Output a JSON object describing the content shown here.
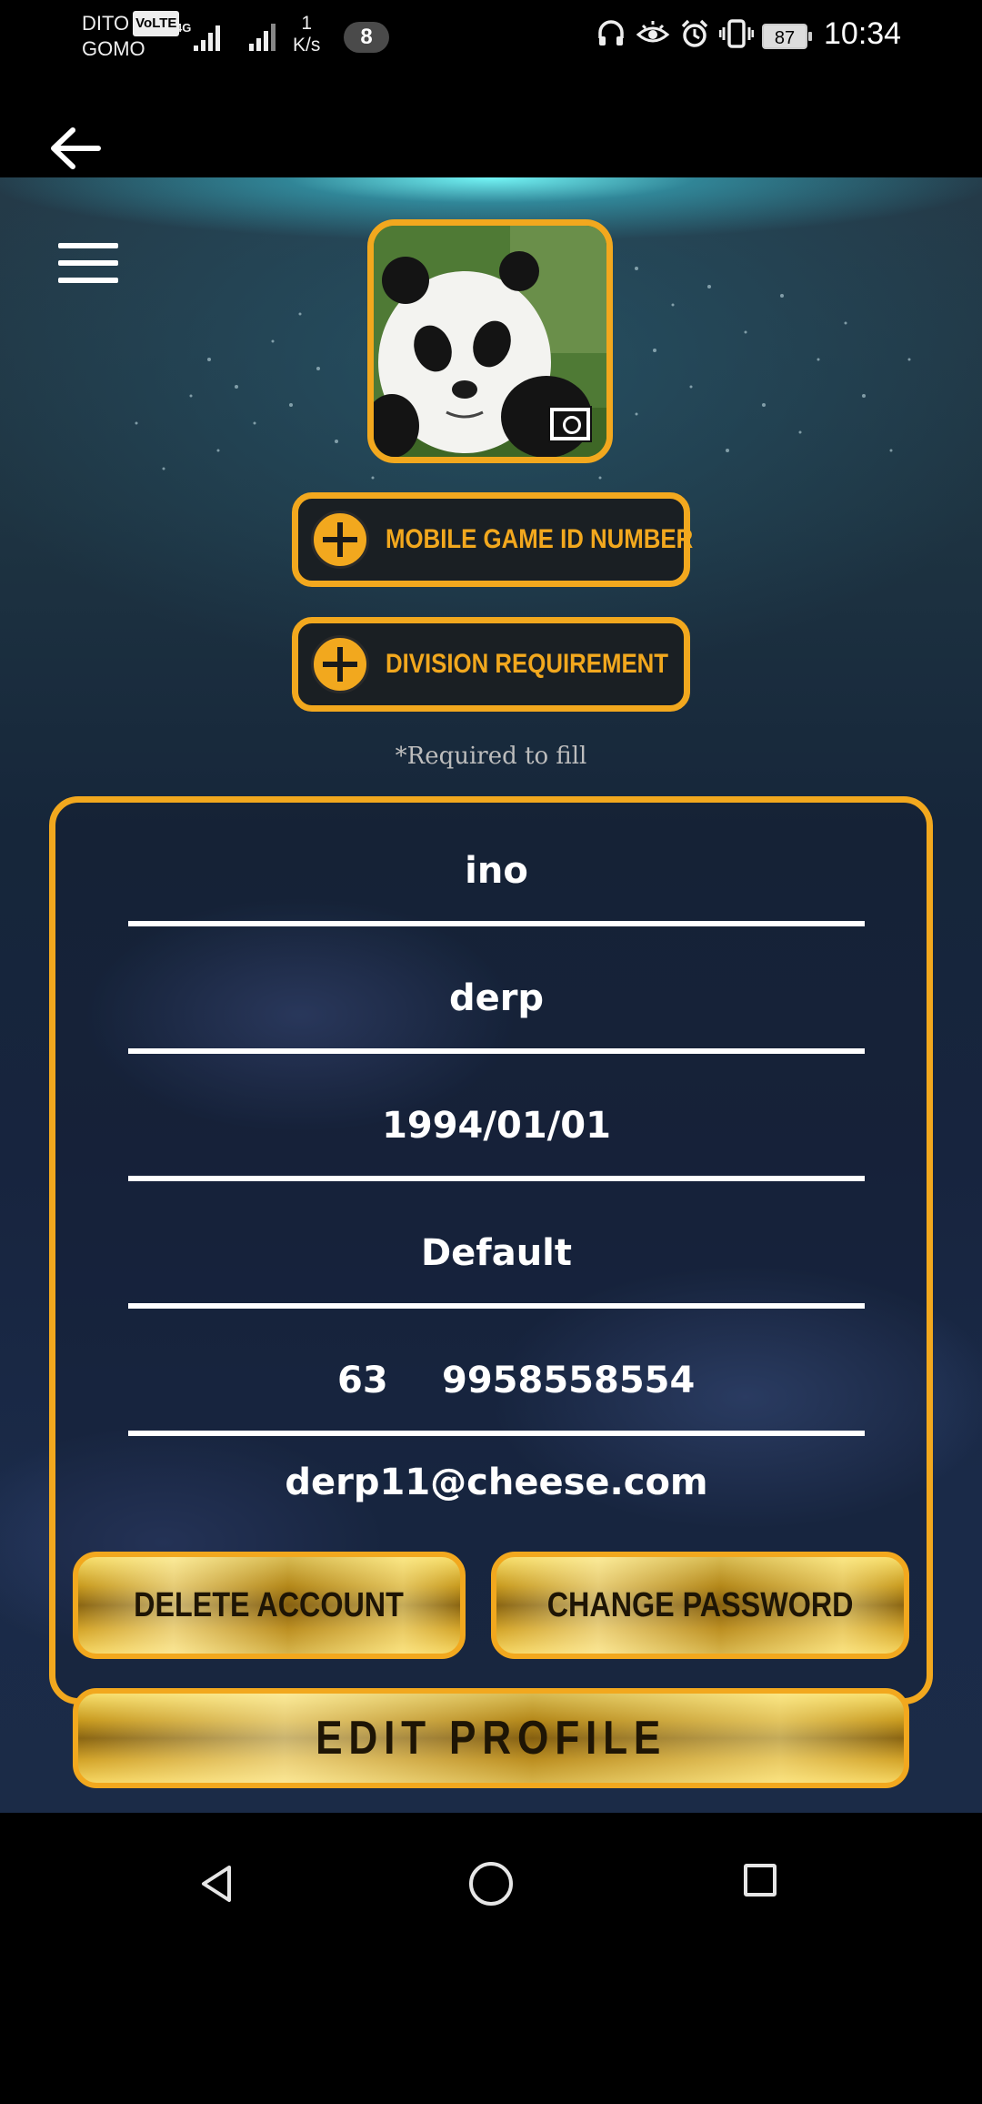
{
  "status_bar": {
    "carrier_top": "DITO",
    "volte": "VoLTE",
    "carrier_bottom": "GOMO",
    "network_type": "4G",
    "net_speed_value": "1",
    "net_speed_unit": "K/s",
    "notification_count": "8",
    "battery": "87",
    "time": "10:34"
  },
  "profile": {
    "add_buttons": [
      {
        "label": "MOBILE GAME ID NUMBER"
      },
      {
        "label": "DIVISION REQUIREMENT"
      }
    ],
    "required_note": "*Required to fill",
    "fields": {
      "first_name": "ino",
      "last_name": "derp",
      "birthdate": "1994/01/01",
      "gender": "Default",
      "phone_code": "63",
      "phone_number": "9958558554",
      "email": "derp11@cheese.com"
    },
    "buttons": {
      "delete": "DELETE ACCOUNT",
      "change_password": "CHANGE PASSWORD",
      "edit": "EDIT PROFILE"
    }
  },
  "colors": {
    "accent": "#f2a81e",
    "background": "#1b2b47"
  },
  "icons": [
    "back-arrow-icon",
    "hamburger-menu-icon",
    "camera-icon",
    "plus-icon",
    "nav-back-icon",
    "nav-home-icon",
    "nav-recent-icon"
  ]
}
